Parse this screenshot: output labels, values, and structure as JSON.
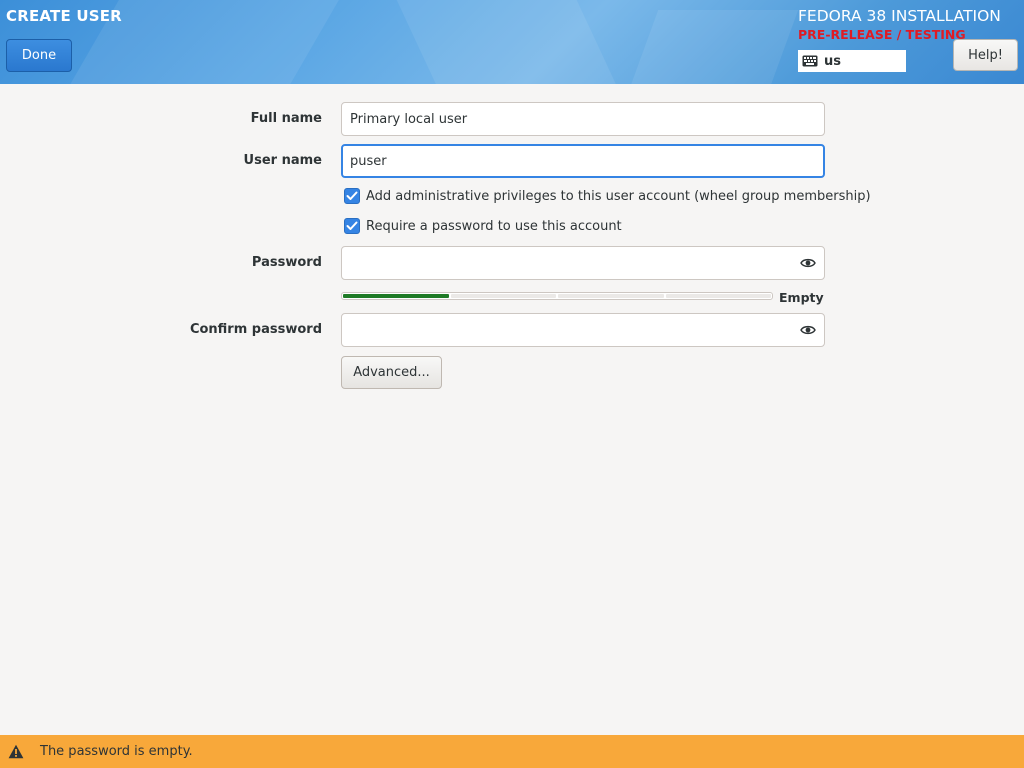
{
  "header": {
    "page_title": "CREATE USER",
    "done_label": "Done",
    "product_title": "FEDORA 38 INSTALLATION",
    "prerelease": "PRE-RELEASE / TESTING",
    "keyboard_layout": "us",
    "help_label": "Help!"
  },
  "form": {
    "full_name_label": "Full name",
    "full_name_value": "Primary local user",
    "user_name_label": "User name",
    "user_name_value": "puser",
    "admin_checkbox_label": "Add administrative privileges to this user account (wheel group membership)",
    "admin_checked": true,
    "require_password_label": "Require a password to use this account",
    "require_password_checked": true,
    "password_label": "Password",
    "password_value": "",
    "strength_level": 0.25,
    "strength_text": "Empty",
    "confirm_password_label": "Confirm password",
    "confirm_password_value": "",
    "advanced_label": "Advanced..."
  },
  "status": {
    "message": "The password is empty."
  },
  "colors": {
    "accent": "#3584e4",
    "strength_fill": "#1e7a25",
    "warning_bar": "#f8a83a",
    "prerelease": "#e01b24"
  },
  "icons": {
    "keyboard": "keyboard-icon",
    "eye": "eye-icon",
    "warning": "warning-icon"
  }
}
